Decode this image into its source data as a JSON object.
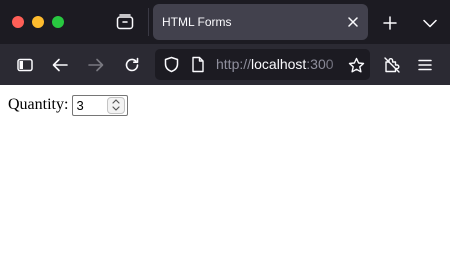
{
  "browser": {
    "tab_title": "HTML Forms",
    "url_prefix": "http://",
    "url_host": "localhost",
    "url_port_visible": ":300"
  },
  "icons": {
    "window_close": "close-dot",
    "window_minimize": "minimize-dot",
    "window_zoom": "zoom-dot",
    "tab_overview": "tab-overview-icon",
    "tab_close": "close-icon",
    "new_tab": "plus-icon",
    "tab_list": "chevron-down-icon",
    "sidebar": "sidebar-icon",
    "back": "back-arrow-icon",
    "forward": "forward-arrow-icon",
    "reload": "reload-icon",
    "tracking_protection": "shield-icon",
    "page_info": "page-icon",
    "bookmark": "star-icon",
    "extensions": "puzzle-icon",
    "app_menu": "hamburger-menu-icon"
  },
  "colors": {
    "tabbar_bg": "#1c1b22",
    "active_tab_bg": "#42414d",
    "toolbar_bg": "#2b2a33",
    "urlbar_bg": "#1c1b22",
    "red": "#ff5f57",
    "yellow": "#febc2e",
    "green": "#28c840"
  },
  "form": {
    "quantity_label": "Quantity:",
    "quantity_value": "3"
  }
}
